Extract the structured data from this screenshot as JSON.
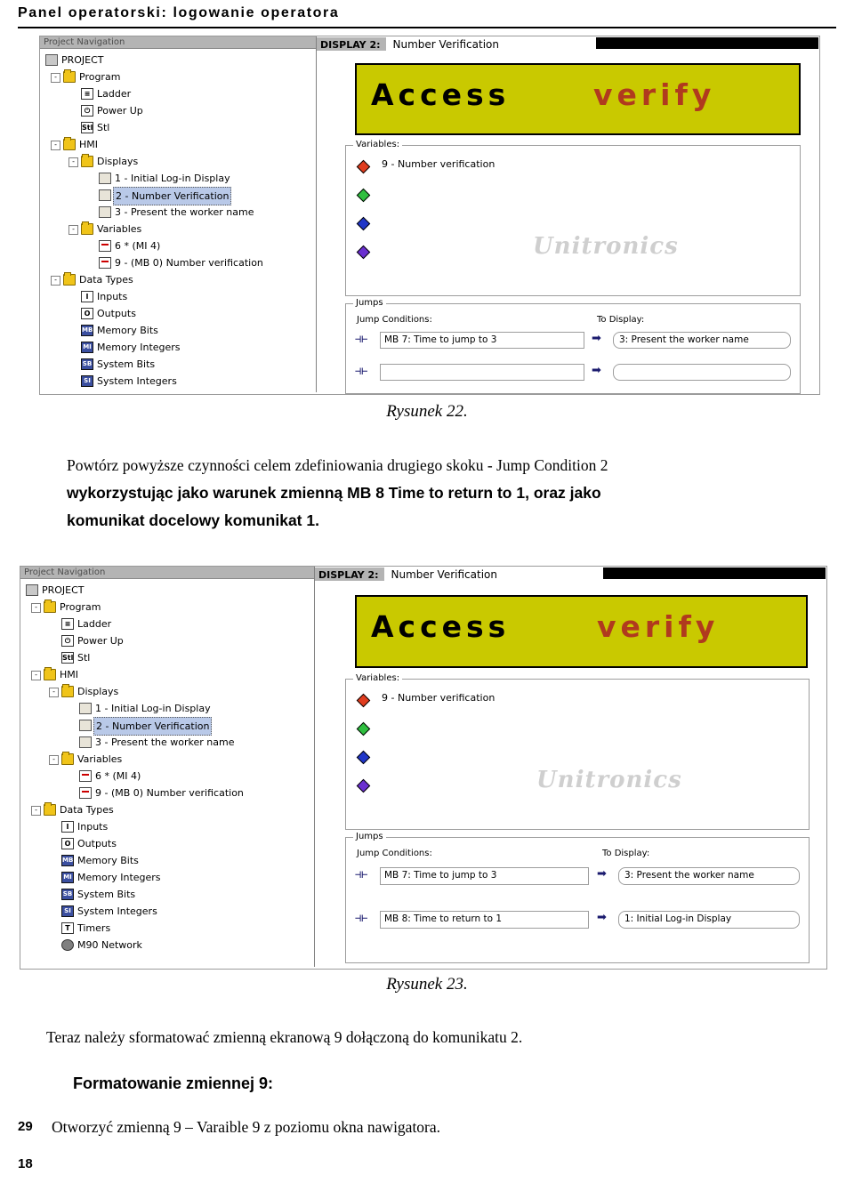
{
  "header": {
    "title": "Panel operatorski: logowanie operatora"
  },
  "figure1": {
    "nav_caption": "Project Navigation",
    "tree": [
      {
        "label": "PROJECT",
        "icon": "project-icon",
        "depth": 0,
        "expander": "",
        "selected": false
      },
      {
        "label": "Program",
        "icon": "folder-icon",
        "depth": 1,
        "expander": "-",
        "selected": false
      },
      {
        "label": "Ladder",
        "icon": "ladder-icon",
        "depth": 2,
        "expander": "",
        "selected": false
      },
      {
        "label": "Power Up",
        "icon": "power-up-icon",
        "depth": 2,
        "expander": "",
        "selected": false
      },
      {
        "label": "Stl",
        "icon": "stl-icon",
        "depth": 2,
        "expander": "",
        "selected": false
      },
      {
        "label": "HMI",
        "icon": "folder-icon",
        "depth": 1,
        "expander": "-",
        "selected": false
      },
      {
        "label": "Displays",
        "icon": "folder-icon",
        "depth": 2,
        "expander": "-",
        "selected": false
      },
      {
        "label": "1 - Initial Log-in Display",
        "icon": "display-icon",
        "depth": 3,
        "expander": "",
        "selected": false
      },
      {
        "label": "2 - Number Verification",
        "icon": "display-icon",
        "depth": 3,
        "expander": "",
        "selected": true
      },
      {
        "label": "3 - Present the worker name",
        "icon": "display-icon",
        "depth": 3,
        "expander": "",
        "selected": false
      },
      {
        "label": "Variables",
        "icon": "folder-icon",
        "depth": 2,
        "expander": "-",
        "selected": false
      },
      {
        "label": "6 * (MI 4)",
        "icon": "variable-icon",
        "depth": 3,
        "expander": "",
        "selected": false
      },
      {
        "label": "9 - (MB 0) Number verification",
        "icon": "variable-icon",
        "depth": 3,
        "expander": "",
        "selected": false
      },
      {
        "label": "Data Types",
        "icon": "folder-icon",
        "depth": 1,
        "expander": "-",
        "selected": false
      },
      {
        "label": "Inputs",
        "icon": "inputs-icon",
        "depth": 2,
        "expander": "",
        "selected": false
      },
      {
        "label": "Outputs",
        "icon": "outputs-icon",
        "depth": 2,
        "expander": "",
        "selected": false
      },
      {
        "label": "Memory Bits",
        "icon": "memory-bits-icon",
        "depth": 2,
        "expander": "",
        "selected": false
      },
      {
        "label": "Memory Integers",
        "icon": "memory-integers-icon",
        "depth": 2,
        "expander": "",
        "selected": false
      },
      {
        "label": "System Bits",
        "icon": "system-bits-icon",
        "depth": 2,
        "expander": "",
        "selected": false
      },
      {
        "label": "System Integers",
        "icon": "system-integers-icon",
        "depth": 2,
        "expander": "",
        "selected": false
      }
    ],
    "display_label": "DISPLAY 2:",
    "display_name": "Number Verification",
    "screen_text_primary": "Access",
    "screen_text_secondary": "verify",
    "variables_caption": "Variables:",
    "variables": [
      {
        "label": "9 - Number verification",
        "color": "#e03c1e"
      },
      {
        "label": "",
        "color": "#2fbf3f"
      },
      {
        "label": "",
        "color": "#2036c8"
      },
      {
        "label": "",
        "color": "#6a2fd0"
      }
    ],
    "watermark": "Unitronics",
    "jumps_caption": "Jumps",
    "jump_conditions_label": "Jump Conditions:",
    "to_display_label": "To Display:",
    "jumps": [
      {
        "condition": "MB 7: Time to jump to 3",
        "target": "3: Present the worker name"
      },
      {
        "condition": "",
        "target": ""
      }
    ]
  },
  "caption1": "Rysunek 22.",
  "paragraph1": {
    "line1": "Powtórz powyższe czynności celem zdefiniowania drugiego skoku - Jump Condition 2",
    "line2_sans": "wykorzystując jako warunek zmienną MB 8 Time to return to 1, oraz jako",
    "line3_sans": "komunikat docelowy komunikat 1."
  },
  "figure2": {
    "nav_caption": "Project Navigation",
    "tree": [
      {
        "label": "PROJECT",
        "icon": "project-icon",
        "depth": 0,
        "expander": "",
        "selected": false
      },
      {
        "label": "Program",
        "icon": "folder-icon",
        "depth": 1,
        "expander": "-",
        "selected": false
      },
      {
        "label": "Ladder",
        "icon": "ladder-icon",
        "depth": 2,
        "expander": "",
        "selected": false
      },
      {
        "label": "Power Up",
        "icon": "power-up-icon",
        "depth": 2,
        "expander": "",
        "selected": false
      },
      {
        "label": "Stl",
        "icon": "stl-icon",
        "depth": 2,
        "expander": "",
        "selected": false
      },
      {
        "label": "HMI",
        "icon": "folder-icon",
        "depth": 1,
        "expander": "-",
        "selected": false
      },
      {
        "label": "Displays",
        "icon": "folder-icon",
        "depth": 2,
        "expander": "-",
        "selected": false
      },
      {
        "label": "1 - Initial Log-in Display",
        "icon": "display-icon",
        "depth": 3,
        "expander": "",
        "selected": false
      },
      {
        "label": "2 - Number Verification",
        "icon": "display-icon",
        "depth": 3,
        "expander": "",
        "selected": true
      },
      {
        "label": "3 - Present the worker name",
        "icon": "display-icon",
        "depth": 3,
        "expander": "",
        "selected": false
      },
      {
        "label": "Variables",
        "icon": "folder-icon",
        "depth": 2,
        "expander": "-",
        "selected": false
      },
      {
        "label": "6 * (MI 4)",
        "icon": "variable-icon",
        "depth": 3,
        "expander": "",
        "selected": false
      },
      {
        "label": "9 - (MB 0) Number verification",
        "icon": "variable-icon",
        "depth": 3,
        "expander": "",
        "selected": false
      },
      {
        "label": "Data Types",
        "icon": "folder-icon",
        "depth": 1,
        "expander": "-",
        "selected": false
      },
      {
        "label": "Inputs",
        "icon": "inputs-icon",
        "depth": 2,
        "expander": "",
        "selected": false
      },
      {
        "label": "Outputs",
        "icon": "outputs-icon",
        "depth": 2,
        "expander": "",
        "selected": false
      },
      {
        "label": "Memory Bits",
        "icon": "memory-bits-icon",
        "depth": 2,
        "expander": "",
        "selected": false
      },
      {
        "label": "Memory Integers",
        "icon": "memory-integers-icon",
        "depth": 2,
        "expander": "",
        "selected": false
      },
      {
        "label": "System Bits",
        "icon": "system-bits-icon",
        "depth": 2,
        "expander": "",
        "selected": false
      },
      {
        "label": "System Integers",
        "icon": "system-integers-icon",
        "depth": 2,
        "expander": "",
        "selected": false
      },
      {
        "label": "Timers",
        "icon": "timers-icon",
        "depth": 2,
        "expander": "",
        "selected": false
      },
      {
        "label": "M90 Network",
        "icon": "network-icon",
        "depth": 2,
        "expander": "",
        "selected": false
      }
    ],
    "display_label": "DISPLAY 2:",
    "display_name": "Number Verification",
    "screen_text_primary": "Access",
    "screen_text_secondary": "verify",
    "variables_caption": "Variables:",
    "variables": [
      {
        "label": "9 - Number verification",
        "color": "#e03c1e"
      },
      {
        "label": "",
        "color": "#2fbf3f"
      },
      {
        "label": "",
        "color": "#2036c8"
      },
      {
        "label": "",
        "color": "#6a2fd0"
      }
    ],
    "watermark": "Unitronics",
    "jumps_caption": "Jumps",
    "jump_conditions_label": "Jump Conditions:",
    "to_display_label": "To Display:",
    "jumps": [
      {
        "condition": "MB 7: Time to jump to 3",
        "target": "3: Present the worker name"
      },
      {
        "condition": "MB 8: Time to return to 1",
        "target": "1: Initial Log-in Display"
      }
    ]
  },
  "caption2": "Rysunek 23.",
  "paragraph2": "Teraz należy sformatować zmienną ekranową 9 dołączoną do komunikatu 2.",
  "heading2": "Formatowanie zmiennej 9:",
  "step": {
    "number": "29",
    "text": "Otworzyć zmienną 9 – Varaible 9 z poziomu okna nawigatora."
  },
  "page_number": "18"
}
